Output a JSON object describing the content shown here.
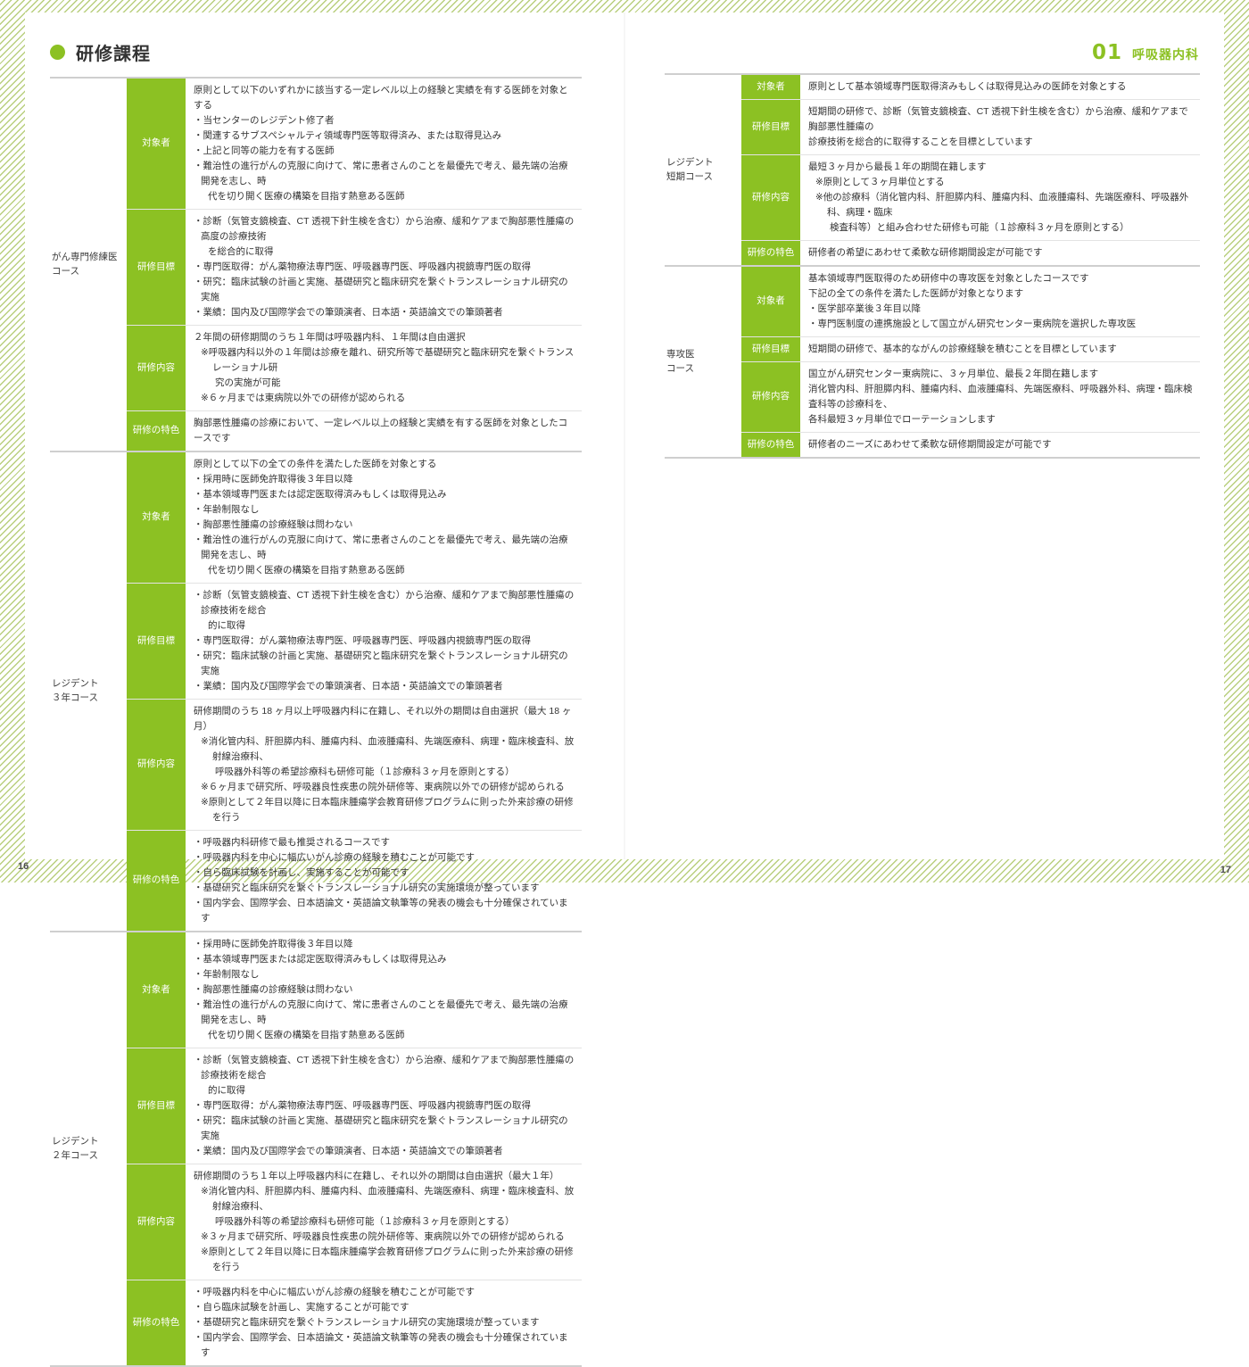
{
  "page": {
    "left_number": "16",
    "right_number": "17",
    "accent_color": "#8CC123"
  },
  "left_header": {
    "icon": "bullet-dot",
    "title": "研修課程"
  },
  "right_header": {
    "number": "01",
    "name": "呼吸器内科"
  },
  "labels": {
    "target": "対象者",
    "goal": "研修目標",
    "content": "研修内容",
    "feature": "研修の特色"
  },
  "left_courses": [
    {
      "name": "がん専門修練医\nコース",
      "rows": [
        {
          "label": "対象者",
          "lines": [
            {
              "cls": "",
              "t": "原則として以下のいずれかに該当する一定レベル以上の経験と実績を有する医師を対象とする"
            },
            {
              "cls": "bullet",
              "t": "・当センターのレジデント修了者"
            },
            {
              "cls": "bullet",
              "t": "・関連するサブスペシャルティ領域専門医等取得済み、または取得見込み"
            },
            {
              "cls": "bullet",
              "t": "・上記と同等の能力を有する医師"
            },
            {
              "cls": "bullet",
              "t": "・難治性の進行がんの克服に向けて、常に患者さんのことを最優先で考え、最先端の治療開発を志し、時"
            },
            {
              "cls": "cont",
              "t": "代を切り開く医療の構築を目指す熱意ある医師"
            }
          ]
        },
        {
          "label": "研修目標",
          "lines": [
            {
              "cls": "bullet",
              "t": "・診断（気管支鏡検査、CT 透視下針生検を含む）から治療、緩和ケアまで胸部悪性腫瘍の高度の診療技術"
            },
            {
              "cls": "cont",
              "t": "を総合的に取得"
            },
            {
              "cls": "bullet",
              "t": "・専門医取得：がん薬物療法専門医、呼吸器専門医、呼吸器内視鏡専門医の取得"
            },
            {
              "cls": "bullet",
              "t": "・研究：臨床試験の計画と実施、基礎研究と臨床研究を繋ぐトランスレーショナル研究の実施"
            },
            {
              "cls": "bullet",
              "t": "・業績：国内及び国際学会での筆頭演者、日本語・英語論文での筆頭著者"
            }
          ]
        },
        {
          "label": "研修内容",
          "lines": [
            {
              "cls": "",
              "t": "２年間の研修期間のうち１年間は呼吸器内科、１年間は自由選択"
            },
            {
              "cls": "note",
              "t": "※呼吸器内科以外の１年間は診療を離れ、研究所等で基礎研究と臨床研究を繋ぐトランスレーショナル研"
            },
            {
              "cls": "cont2",
              "t": "究の実施が可能"
            },
            {
              "cls": "note",
              "t": "※６ヶ月までは東病院以外での研修が認められる"
            }
          ]
        },
        {
          "label": "研修の特色",
          "lines": [
            {
              "cls": "",
              "t": "胸部悪性腫瘍の診療において、一定レベル以上の経験と実績を有する医師を対象としたコースです"
            }
          ]
        }
      ]
    },
    {
      "name": "レジデント\n３年コース",
      "rows": [
        {
          "label": "対象者",
          "lines": [
            {
              "cls": "",
              "t": "原則として以下の全ての条件を満たした医師を対象とする"
            },
            {
              "cls": "bullet",
              "t": "・採用時に医師免許取得後３年目以降"
            },
            {
              "cls": "bullet",
              "t": "・基本領域専門医または認定医取得済みもしくは取得見込み"
            },
            {
              "cls": "bullet",
              "t": "・年齢制限なし"
            },
            {
              "cls": "bullet",
              "t": "・胸部悪性腫瘍の診療経験は問わない"
            },
            {
              "cls": "bullet",
              "t": "・難治性の進行がんの克服に向けて、常に患者さんのことを最優先で考え、最先端の治療開発を志し、時"
            },
            {
              "cls": "cont",
              "t": "代を切り開く医療の構築を目指す熱意ある医師"
            }
          ]
        },
        {
          "label": "研修目標",
          "lines": [
            {
              "cls": "bullet",
              "t": "・診断（気管支鏡検査、CT 透視下針生検を含む）から治療、緩和ケアまで胸部悪性腫瘍の診療技術を総合"
            },
            {
              "cls": "cont",
              "t": "的に取得"
            },
            {
              "cls": "bullet",
              "t": "・専門医取得：がん薬物療法専門医、呼吸器専門医、呼吸器内視鏡専門医の取得"
            },
            {
              "cls": "bullet",
              "t": "・研究：臨床試験の計画と実施、基礎研究と臨床研究を繋ぐトランスレーショナル研究の実施"
            },
            {
              "cls": "bullet",
              "t": "・業績：国内及び国際学会での筆頭演者、日本語・英語論文での筆頭著者"
            }
          ]
        },
        {
          "label": "研修内容",
          "lines": [
            {
              "cls": "",
              "t": "研修期間のうち 18 ヶ月以上呼吸器内科に在籍し、それ以外の期間は自由選択（最大 18 ヶ月）"
            },
            {
              "cls": "note",
              "t": "※消化管内科、肝胆膵内科、腫瘍内科、血液腫瘍科、先端医療科、病理・臨床検査科、放射線治療科、"
            },
            {
              "cls": "cont2",
              "t": "呼吸器外科等の希望診療科も研修可能（１診療科３ヶ月を原則とする）"
            },
            {
              "cls": "note",
              "t": "※６ヶ月まで研究所、呼吸器良性疾患の院外研修等、東病院以外での研修が認められる"
            },
            {
              "cls": "note",
              "t": "※原則として２年目以降に日本臨床腫瘍学会教育研修プログラムに則った外来診療の研修を行う"
            }
          ]
        },
        {
          "label": "研修の特色",
          "lines": [
            {
              "cls": "bullet",
              "t": "・呼吸器内科研修で最も推奨されるコースです"
            },
            {
              "cls": "bullet",
              "t": "・呼吸器内科を中心に幅広いがん診療の経験を積むことが可能です"
            },
            {
              "cls": "bullet",
              "t": "・自ら臨床試験を計画し、実施することが可能です"
            },
            {
              "cls": "bullet",
              "t": "・基礎研究と臨床研究を繋ぐトランスレーショナル研究の実施環境が整っています"
            },
            {
              "cls": "bullet",
              "t": "・国内学会、国際学会、日本語論文・英語論文執筆等の発表の機会も十分確保されています"
            }
          ]
        }
      ]
    },
    {
      "name": "レジデント\n２年コース",
      "rows": [
        {
          "label": "対象者",
          "lines": [
            {
              "cls": "bullet",
              "t": "・採用時に医師免許取得後３年目以降"
            },
            {
              "cls": "bullet",
              "t": "・基本領域専門医または認定医取得済みもしくは取得見込み"
            },
            {
              "cls": "bullet",
              "t": "・年齢制限なし"
            },
            {
              "cls": "bullet",
              "t": "・胸部悪性腫瘍の診療経験は問わない"
            },
            {
              "cls": "bullet",
              "t": "・難治性の進行がんの克服に向けて、常に患者さんのことを最優先で考え、最先端の治療開発を志し、時"
            },
            {
              "cls": "cont",
              "t": "代を切り開く医療の構築を目指す熱意ある医師"
            }
          ]
        },
        {
          "label": "研修目標",
          "lines": [
            {
              "cls": "bullet",
              "t": "・診断（気管支鏡検査、CT 透視下針生検を含む）から治療、緩和ケアまで胸部悪性腫瘍の診療技術を総合"
            },
            {
              "cls": "cont",
              "t": "的に取得"
            },
            {
              "cls": "bullet",
              "t": "・専門医取得：がん薬物療法専門医、呼吸器専門医、呼吸器内視鏡専門医の取得"
            },
            {
              "cls": "bullet",
              "t": "・研究：臨床試験の計画と実施、基礎研究と臨床研究を繋ぐトランスレーショナル研究の実施"
            },
            {
              "cls": "bullet",
              "t": "・業績：国内及び国際学会での筆頭演者、日本語・英語論文での筆頭著者"
            }
          ]
        },
        {
          "label": "研修内容",
          "lines": [
            {
              "cls": "",
              "t": "研修期間のうち１年以上呼吸器内科に在籍し、それ以外の期間は自由選択（最大１年）"
            },
            {
              "cls": "note",
              "t": "※消化管内科、肝胆膵内科、腫瘍内科、血液腫瘍科、先端医療科、病理・臨床検査科、放射線治療科、"
            },
            {
              "cls": "cont2",
              "t": "呼吸器外科等の希望診療科も研修可能（１診療科３ヶ月を原則とする）"
            },
            {
              "cls": "note",
              "t": "※３ヶ月まで研究所、呼吸器良性疾患の院外研修等、東病院以外での研修が認められる"
            },
            {
              "cls": "note",
              "t": "※原則として２年目以降に日本臨床腫瘍学会教育研修プログラムに則った外来診療の研修を行う"
            }
          ]
        },
        {
          "label": "研修の特色",
          "lines": [
            {
              "cls": "bullet",
              "t": "・呼吸器内科を中心に幅広いがん診療の経験を積むことが可能です"
            },
            {
              "cls": "bullet",
              "t": "・自ら臨床試験を計画し、実施することが可能です"
            },
            {
              "cls": "bullet",
              "t": "・基礎研究と臨床研究を繋ぐトランスレーショナル研究の実施環境が整っています"
            },
            {
              "cls": "bullet",
              "t": "・国内学会、国際学会、日本語論文・英語論文執筆等の発表の機会も十分確保されています"
            }
          ]
        }
      ]
    }
  ],
  "right_courses": [
    {
      "name": "レジデント\n短期コース",
      "rows": [
        {
          "label": "対象者",
          "lines": [
            {
              "cls": "",
              "t": "原則として基本領域専門医取得済みもしくは取得見込みの医師を対象とする"
            }
          ]
        },
        {
          "label": "研修目標",
          "lines": [
            {
              "cls": "",
              "t": "短期間の研修で、診断（気管支鏡検査、CT 透視下針生検を含む）から治療、緩和ケアまで胸部悪性腫瘍の"
            },
            {
              "cls": "",
              "t": "診療技術を総合的に取得することを目標としています"
            }
          ]
        },
        {
          "label": "研修内容",
          "lines": [
            {
              "cls": "",
              "t": "最短３ヶ月から最長１年の期間在籍します"
            },
            {
              "cls": "note",
              "t": "※原則として３ヶ月単位とする"
            },
            {
              "cls": "note",
              "t": "※他の診療科（消化管内科、肝胆膵内科、腫瘍内科、血液腫瘍科、先端医療科、呼吸器外科、病理・臨床"
            },
            {
              "cls": "cont2",
              "t": "検査科等）と組み合わせた研修も可能（１診療科３ヶ月を原則とする）"
            }
          ]
        },
        {
          "label": "研修の特色",
          "lines": [
            {
              "cls": "",
              "t": "研修者の希望にあわせて柔軟な研修期間設定が可能です"
            }
          ]
        }
      ]
    },
    {
      "name": "専攻医\nコース",
      "rows": [
        {
          "label": "対象者",
          "lines": [
            {
              "cls": "",
              "t": "基本領域専門医取得のため研修中の専攻医を対象としたコースです"
            },
            {
              "cls": "",
              "t": "下記の全ての条件を満たした医師が対象となります"
            },
            {
              "cls": "bullet",
              "t": "・医学部卒業後３年目以降"
            },
            {
              "cls": "bullet",
              "t": "・専門医制度の連携施設として国立がん研究センター東病院を選択した専攻医"
            }
          ]
        },
        {
          "label": "研修目標",
          "lines": [
            {
              "cls": "",
              "t": "短期間の研修で、基本的ながんの診療経験を積むことを目標としています"
            }
          ]
        },
        {
          "label": "研修内容",
          "lines": [
            {
              "cls": "",
              "t": "国立がん研究センター東病院に、３ヶ月単位、最長２年間在籍します"
            },
            {
              "cls": "",
              "t": "消化管内科、肝胆膵内科、腫瘍内科、血液腫瘍科、先端医療科、呼吸器外科、病理・臨床検査科等の診療科を、"
            },
            {
              "cls": "",
              "t": "各科最短３ヶ月単位でローテーションします"
            }
          ]
        },
        {
          "label": "研修の特色",
          "lines": [
            {
              "cls": "",
              "t": "研修者のニーズにあわせて柔軟な研修期間設定が可能です"
            }
          ]
        }
      ]
    }
  ]
}
